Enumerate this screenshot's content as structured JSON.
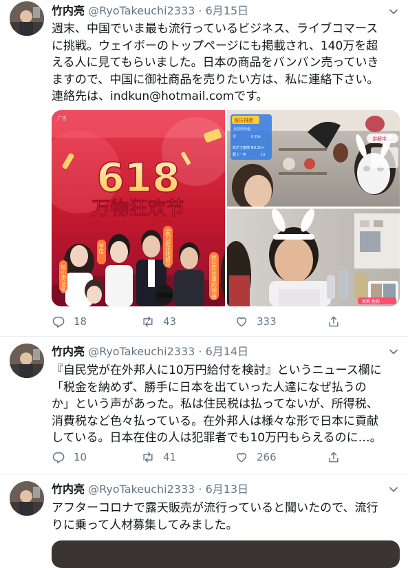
{
  "tweets": [
    {
      "name": "竹内亮",
      "handle": "@RyoTakeuchi2333",
      "date": "6月15日",
      "lines": [
        "週末、中国でいま最も流行っているビジネス、ライブコマース",
        "に挑戦。ウェイボーのトップページにも掲載され、140万を超",
        "える人に見てもらいました。日本の商品をバンバン売っていき",
        "ますので、中国に御社商品を売りたい方は、私に連絡下さい。",
        "連絡先は、indkun@hotmail.comです。"
      ],
      "replies": "18",
      "retweets": "43",
      "likes": "333",
      "media": {
        "banner_ad": "广告",
        "banner_top": "618",
        "banner_bottom": "万物狂欢节",
        "live_panel_title": "涨乐排度",
        "live_panel_sub": "当前欢乐值",
        "live_panel_row1": "欢乐王座榜 NO.20+",
        "live_panel_row2": "距上一名",
        "live_panel_val1": "0",
        "live_panel_val2": "10",
        "live_panel_badge": "0 20s",
        "live_tag": "讲解中...",
        "live_button": "首购 抢购",
        "poster_names": [
          "李佳",
          "提刀捉花花姐北",
          "我住在这里的理由",
          "萌小RoMaa"
        ]
      }
    },
    {
      "name": "竹内亮",
      "handle": "@RyoTakeuchi2333",
      "date": "6月14日",
      "lines": [
        "『自民党が在外邦人に10万円給付を検討』というニュース欄に",
        "「税金を納めず、勝手に日本を出ていった人達になぜ払うの",
        "か」という声があった。私は住民税は払ってないが、所得税、",
        "消費税など色々払っている。在外邦人は様々な形で日本に貢献",
        "している。日本在住の人は犯罪者でも10万円もらえるのに…。"
      ],
      "replies": "10",
      "retweets": "41",
      "likes": "266"
    },
    {
      "name": "竹内亮",
      "handle": "@RyoTakeuchi2333",
      "date": "6月13日",
      "lines": [
        "アフターコロナで露天販売が流行っていると聞いたので、流行",
        "りに乗って人材募集してみました。"
      ]
    }
  ],
  "colors": {
    "text": "#14171a",
    "secondary": "#657786",
    "divider": "#e6ecf0",
    "banner_red": "#c4182e",
    "banner_gold": "#ffd56a"
  },
  "icons": [
    "caret-down-icon",
    "reply-icon",
    "retweet-icon",
    "like-icon",
    "share-icon"
  ]
}
